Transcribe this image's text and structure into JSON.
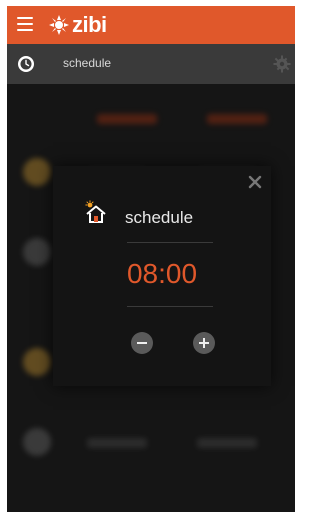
{
  "app": {
    "brand": "zibi"
  },
  "subbar": {
    "title": "schedule"
  },
  "modal": {
    "title": "schedule",
    "time": "08:00"
  },
  "colors": {
    "accent": "#e0582b",
    "background": "#1c1c1c",
    "modal": "#141414"
  },
  "icons": [
    "menu-icon",
    "zibi-logo-icon",
    "clock-icon",
    "gear-icon",
    "close-icon",
    "home-sun-icon",
    "minus-icon",
    "plus-icon"
  ]
}
